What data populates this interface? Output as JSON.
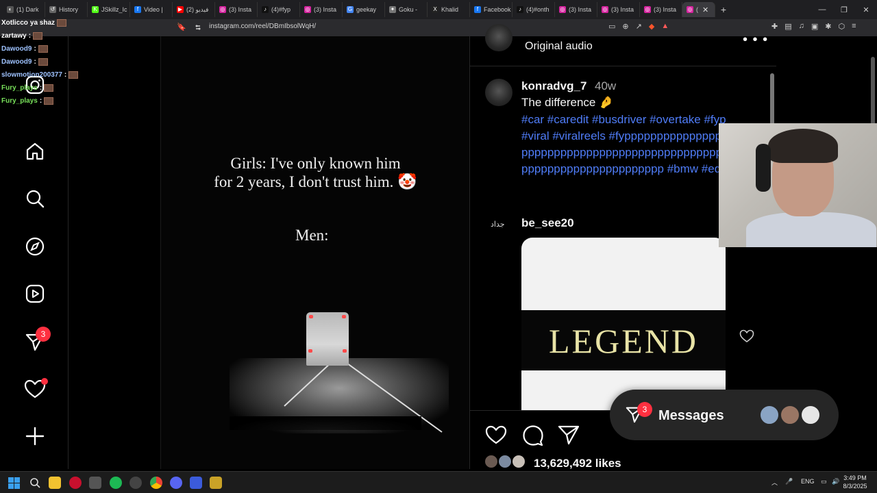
{
  "browser": {
    "tabs": [
      {
        "label": "(1) Dark",
        "color": "#555555",
        "glyph": "◐"
      },
      {
        "label": "History",
        "color": "#666666",
        "glyph": "↺"
      },
      {
        "label": "JSkillz_Ic",
        "color": "#53fc18",
        "glyph": "K"
      },
      {
        "label": "Video |",
        "color": "#1877f2",
        "glyph": "f"
      },
      {
        "label": "فيديو (2)",
        "color": "#ff0000",
        "glyph": "▶"
      },
      {
        "label": "(3) Insta",
        "color": "#d6249f",
        "glyph": "◎"
      },
      {
        "label": "(4)#fyp",
        "color": "#111111",
        "glyph": "♪"
      },
      {
        "label": "(3) Insta",
        "color": "#d6249f",
        "glyph": "◎"
      },
      {
        "label": "geekay",
        "color": "#4285f4",
        "glyph": "G"
      },
      {
        "label": "Goku -",
        "color": "#777777",
        "glyph": "✦"
      },
      {
        "label": "Khalid",
        "color": "#222222",
        "glyph": "X"
      },
      {
        "label": "Facebook",
        "color": "#1877f2",
        "glyph": "f"
      },
      {
        "label": "(4)#onth",
        "color": "#111111",
        "glyph": "♪"
      },
      {
        "label": "(3) Insta",
        "color": "#d6249f",
        "glyph": "◎"
      },
      {
        "label": "(3) Insta",
        "color": "#d6249f",
        "glyph": "◎"
      },
      {
        "label": "(3) Insta",
        "color": "#d6249f",
        "glyph": "◎"
      }
    ],
    "active_tab_label": "(",
    "new_tab": "+",
    "url": "instagram.com/reel/DBmIbsolWqH/"
  },
  "chat": [
    {
      "user": "Xotlicco",
      "text": "ya shaz",
      "color": "white"
    },
    {
      "user": "zartawy",
      "text": ":",
      "color": "white"
    },
    {
      "user": "Dawood9",
      "text": ":",
      "color": "blue"
    },
    {
      "user": "Dawood9",
      "text": ":",
      "color": "blue"
    },
    {
      "user": "slowmotion200377",
      "text": ":",
      "color": "blue"
    },
    {
      "user": "Fury_plays",
      "text": ":",
      "color": "green"
    },
    {
      "user": "Fury_plays",
      "text": ":",
      "color": "green"
    }
  ],
  "sidebar": {
    "messages_badge": "3"
  },
  "reel": {
    "caption_line1": "Girls: I've only known him",
    "caption_line2": "for 2 years, I don't trust him. 🤡",
    "caption_men": "Men:"
  },
  "panel": {
    "header_audio": "Original audio",
    "post": {
      "username": "konradvg_7",
      "age": "40w",
      "text": "The difference 🤌",
      "hashtags": "#car #caredit #busdriver #overtake #fyp #viral #viralreels #fypppppppppppppppppppppppppppppppppppppppppppppppppppppppppppppppppppp #bmw #edit"
    },
    "comment": {
      "username": "be_see20",
      "avatar_text": "جداد",
      "image_word": "LEGEND"
    },
    "likes": "13,629,492 likes"
  },
  "messages": {
    "label": "Messages",
    "badge": "3"
  },
  "taskbar": {
    "lang": "ENG",
    "time": "3:49 PM",
    "date": "8/3/2025"
  },
  "colors": {
    "accent_link": "#4f7cf7",
    "badge_red": "#ff3040",
    "panel_bg": "#000000",
    "pill_bg": "#262626"
  }
}
